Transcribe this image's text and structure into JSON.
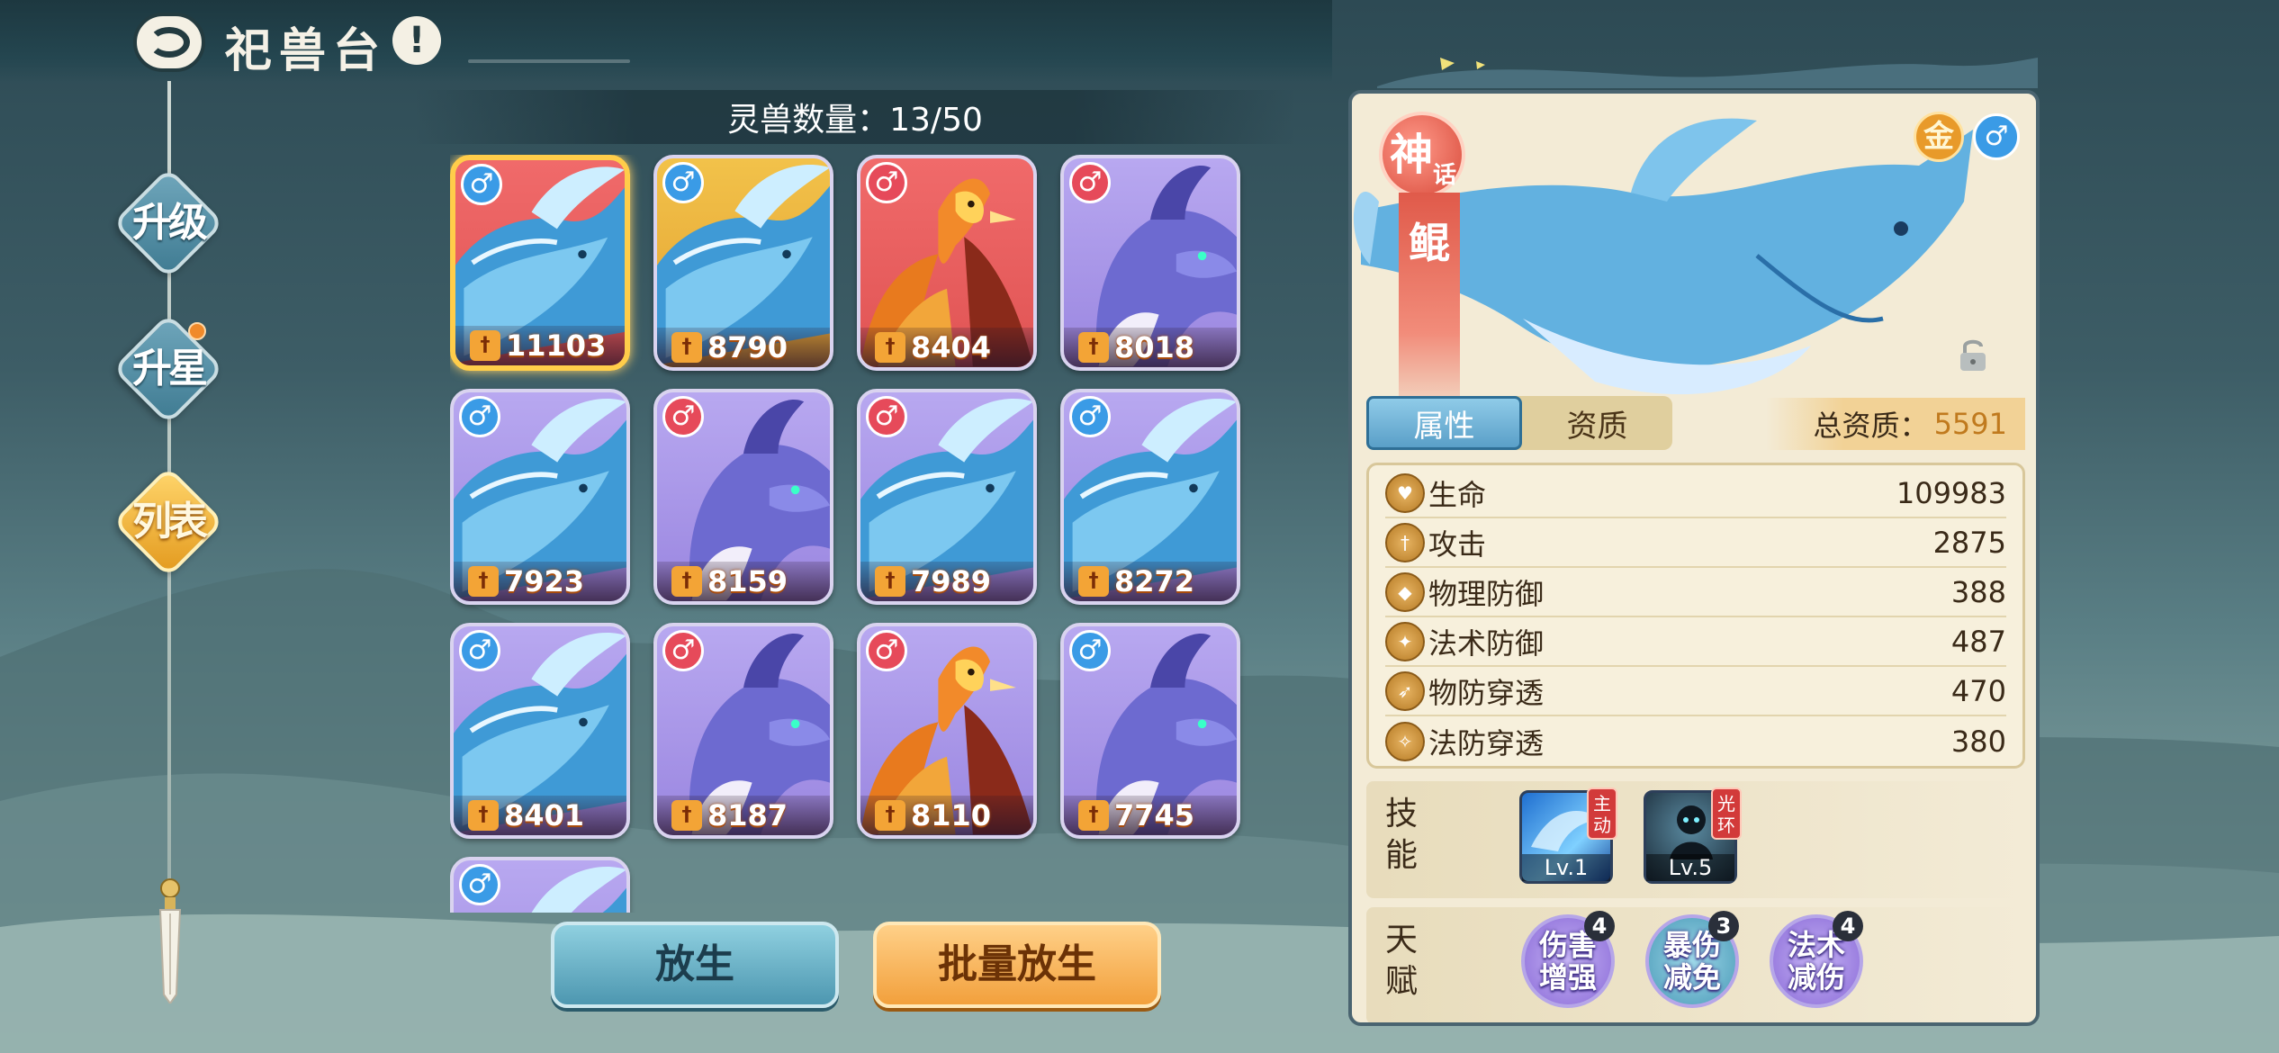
{
  "header": {
    "title": "祀兽台",
    "info_icon": "!"
  },
  "side_tabs": [
    {
      "label": "升级",
      "active": false,
      "dot": false
    },
    {
      "label": "升星",
      "active": false,
      "dot": true
    },
    {
      "label": "列表",
      "active": true,
      "dot": false
    }
  ],
  "pet_count": {
    "text": "灵兽数量：13/50"
  },
  "pets": [
    {
      "power": "11103",
      "gender": "♂",
      "gender_type": "male",
      "art": "whale",
      "bg": "red",
      "selected": true
    },
    {
      "power": "8790",
      "gender": "♂",
      "gender_type": "male",
      "art": "whale",
      "bg": "gold",
      "selected": false
    },
    {
      "power": "8404",
      "gender": "♂",
      "gender_type": "female",
      "art": "phoenix",
      "bg": "red",
      "selected": false
    },
    {
      "power": "8018",
      "gender": "♂",
      "gender_type": "female",
      "art": "dragon",
      "bg": "purple",
      "selected": false
    },
    {
      "power": "7923",
      "gender": "♂",
      "gender_type": "male",
      "art": "whale",
      "bg": "purple",
      "selected": false
    },
    {
      "power": "8159",
      "gender": "♂",
      "gender_type": "female",
      "art": "dragon",
      "bg": "purple",
      "selected": false
    },
    {
      "power": "7989",
      "gender": "♂",
      "gender_type": "female",
      "art": "whale",
      "bg": "purple",
      "selected": false
    },
    {
      "power": "8272",
      "gender": "♂",
      "gender_type": "male",
      "art": "whale",
      "bg": "purple",
      "selected": false
    },
    {
      "power": "8401",
      "gender": "♂",
      "gender_type": "male",
      "art": "whale",
      "bg": "purple",
      "selected": false
    },
    {
      "power": "8187",
      "gender": "♂",
      "gender_type": "female",
      "art": "dragon",
      "bg": "purple",
      "selected": false
    },
    {
      "power": "8110",
      "gender": "♂",
      "gender_type": "female",
      "art": "phoenix",
      "bg": "purple",
      "selected": false
    },
    {
      "power": "7745",
      "gender": "♂",
      "gender_type": "male",
      "art": "dragon",
      "bg": "purple",
      "selected": false
    },
    {
      "power": "",
      "gender": "♂",
      "gender_type": "male",
      "art": "whale",
      "bg": "purple",
      "selected": false
    }
  ],
  "buttons": {
    "release": "放生",
    "batch_release": "批量放生"
  },
  "detail": {
    "rarity_main": "神",
    "rarity_sub": "话",
    "name": "鲲",
    "element": "金",
    "gender": "♂",
    "tabs": [
      "属性",
      "资质"
    ],
    "active_tab": 0,
    "total_label": "总资质：",
    "total_value": "5591",
    "attributes": [
      {
        "name": "生命",
        "value": "109983",
        "icon": "heart-icon"
      },
      {
        "name": "攻击",
        "value": "2875",
        "icon": "sword-icon"
      },
      {
        "name": "物理防御",
        "value": "388",
        "icon": "shield-icon"
      },
      {
        "name": "法术防御",
        "value": "487",
        "icon": "magic-shield-icon"
      },
      {
        "name": "物防穿透",
        "value": "470",
        "icon": "pierce-icon"
      },
      {
        "name": "法防穿透",
        "value": "380",
        "icon": "magic-pierce-icon"
      }
    ],
    "skill_label": "技能",
    "skills": [
      {
        "tag": "主动",
        "level": "Lv.1",
        "icon": "wave-skill-icon"
      },
      {
        "tag": "光环",
        "level": "Lv.5",
        "icon": "shadow-skill-icon"
      }
    ],
    "talent_label": "天赋",
    "talents": [
      {
        "text": "伤害增强",
        "count": "4"
      },
      {
        "text": "暴伤减免",
        "count": "3"
      },
      {
        "text": "法术减伤",
        "count": "4"
      }
    ]
  },
  "colors": {
    "accent_gold": "#ffcd4a",
    "male": "#3a9be6",
    "female": "#e64a5a",
    "panel": "#f3ebd6"
  }
}
